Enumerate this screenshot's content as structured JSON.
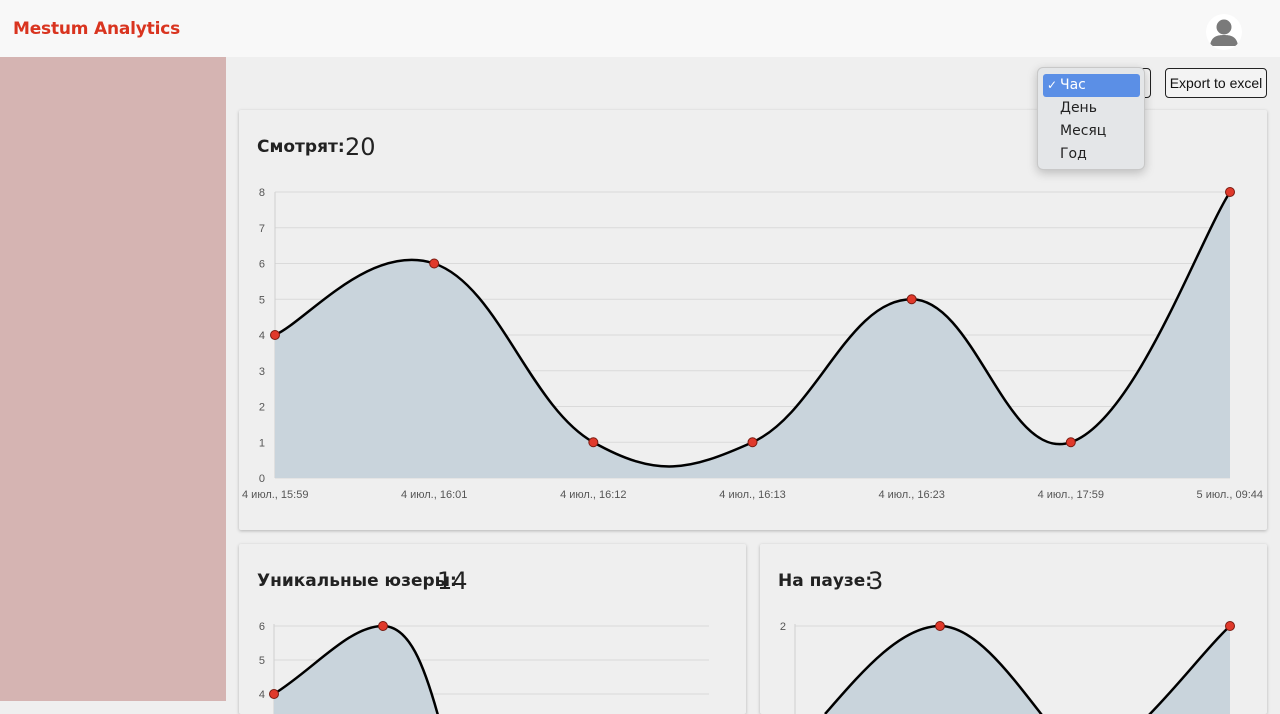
{
  "header": {
    "brand": "Mestum Analytics"
  },
  "toolbar": {
    "period_options": [
      "Час",
      "День",
      "Месяц",
      "Год"
    ],
    "selected_period": "Час",
    "export_label": "Export to excel"
  },
  "cards": {
    "watching": {
      "title": "Смотрят:",
      "value": "20"
    },
    "unique": {
      "title": "Уникальные юзеры:",
      "value": "14"
    },
    "paused": {
      "title": "На паузе:",
      "value": "3"
    }
  },
  "colors": {
    "brand": "#d9341f",
    "point": "#e0392b",
    "fill": "#c9d4dc",
    "sidebar": "#d5b4b2",
    "selected": "#5b8fe6"
  },
  "chart_data": [
    {
      "type": "area",
      "categories": [
        "4 июл., 15:59",
        "4 июл., 16:01",
        "4 июл., 16:12",
        "4 июл., 16:13",
        "4 июл., 16:23",
        "4 июл., 17:59",
        "5 июл., 09:44"
      ],
      "values": [
        4,
        6,
        1,
        1,
        5,
        1,
        8
      ],
      "ylim": [
        0,
        8
      ],
      "yticks": [
        0,
        1,
        2,
        3,
        4,
        5,
        6,
        7,
        8
      ],
      "grid": true
    },
    {
      "type": "area",
      "values": [
        4,
        6
      ],
      "yticks_visible": [
        4,
        5,
        6
      ],
      "grid": true
    },
    {
      "type": "area",
      "values": [
        2
      ],
      "yticks_visible": [
        2
      ],
      "grid": true
    }
  ]
}
